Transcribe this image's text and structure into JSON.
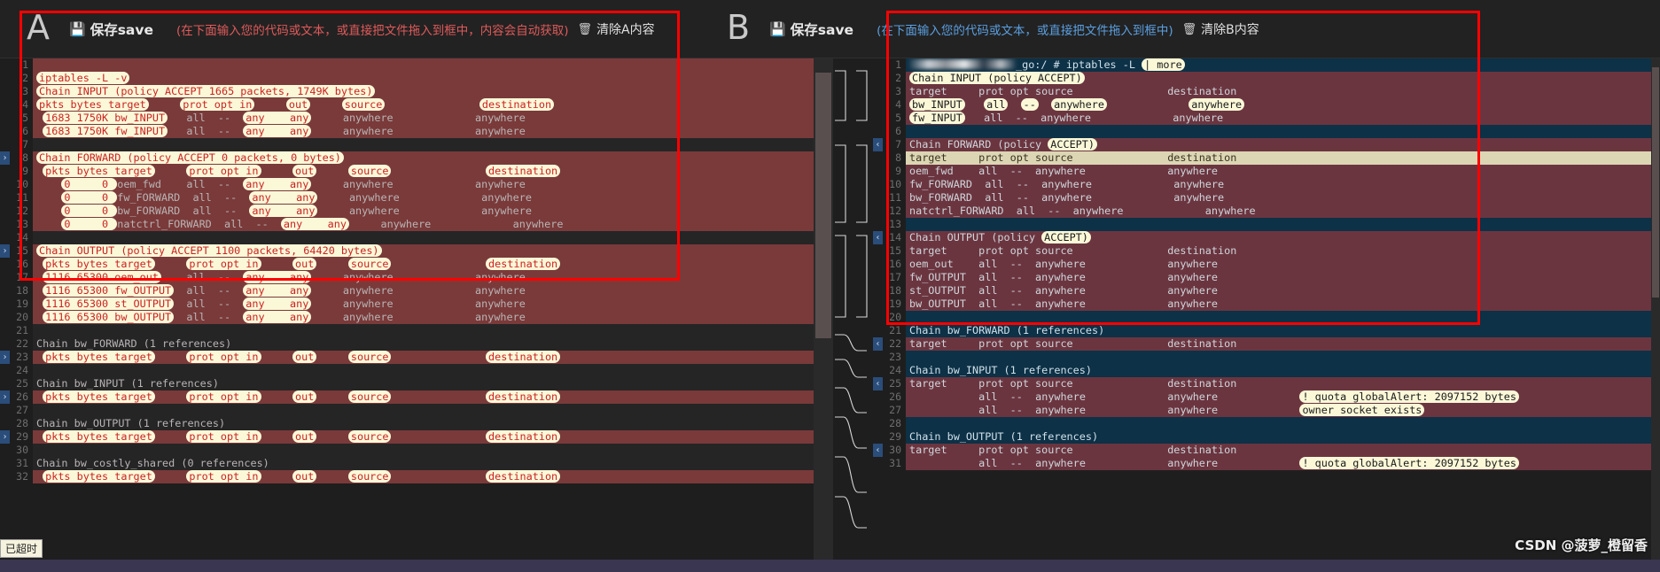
{
  "header": {
    "panel_a": {
      "letter": "A",
      "save_label": "保存save",
      "save_icon": "save-icon",
      "hint": "(在下面输入您的代码或文本，或直接把文件拖入到框中，内容会自动获取)",
      "clear_label": "清除A内容",
      "trash_icon": "trash-icon"
    },
    "panel_b": {
      "letter": "B",
      "save_label": "保存save",
      "save_icon": "save-icon",
      "hint": "(在下面输入您的代码或文本，或直接把文件拖入到框中)",
      "clear_label": "清除B内容",
      "trash_icon": "trash-icon"
    }
  },
  "status": {
    "timeout_badge": "已超时",
    "watermark": "CSDN @菠萝_橙留香"
  },
  "left_pane": {
    "lines": [
      {
        "n": "1",
        "bg": "del",
        "text": "",
        "partial": true
      },
      {
        "n": "2",
        "bg": "del",
        "text": "iptables -L -v",
        "tokens": [
          "iptables -L -v"
        ]
      },
      {
        "n": "3",
        "bg": "del",
        "text": "Chain INPUT (policy ACCEPT 1665 packets, 1749K bytes)"
      },
      {
        "n": "4",
        "bg": "del",
        "text": "pkts bytes target     prot opt in     out     source               destination"
      },
      {
        "n": "5",
        "bg": "del",
        "text": " 1683 1750K bw_INPUT   all  --  any    any     anywhere             anywhere"
      },
      {
        "n": "6",
        "bg": "del",
        "text": " 1683 1750K fw_INPUT   all  --  any    any     anywhere             anywhere"
      },
      {
        "n": "7",
        "bg": "none",
        "text": ""
      },
      {
        "n": "8",
        "bg": "del",
        "text": "Chain FORWARD (policy ACCEPT 0 packets, 0 bytes)",
        "fold": true
      },
      {
        "n": "9",
        "bg": "del",
        "text": " pkts bytes target     prot opt in     out     source               destination"
      },
      {
        "n": "10",
        "bg": "del",
        "text": "    0     0 oem_fwd    all  --  any    any     anywhere             anywhere"
      },
      {
        "n": "11",
        "bg": "del",
        "text": "    0     0 fw_FORWARD  all  --  any    any     anywhere             anywhere"
      },
      {
        "n": "12",
        "bg": "del",
        "text": "    0     0 bw_FORWARD  all  --  any    any     anywhere             anywhere"
      },
      {
        "n": "13",
        "bg": "del",
        "text": "    0     0 natctrl_FORWARD  all  --  any    any     anywhere             anywhere"
      },
      {
        "n": "14",
        "bg": "none",
        "text": ""
      },
      {
        "n": "15",
        "bg": "del",
        "text": "Chain OUTPUT (policy ACCEPT 1100 packets, 64420 bytes)",
        "fold": true
      },
      {
        "n": "16",
        "bg": "del",
        "text": " pkts bytes target     prot opt in     out     source               destination"
      },
      {
        "n": "17",
        "bg": "del",
        "text": " 1116 65300 oem_out    all  --  any    any     anywhere             anywhere"
      },
      {
        "n": "18",
        "bg": "del",
        "text": " 1116 65300 fw_OUTPUT  all  --  any    any     anywhere             anywhere"
      },
      {
        "n": "19",
        "bg": "del",
        "text": " 1116 65300 st_OUTPUT  all  --  any    any     anywhere             anywhere"
      },
      {
        "n": "20",
        "bg": "del",
        "text": " 1116 65300 bw_OUTPUT  all  --  any    any     anywhere             anywhere"
      },
      {
        "n": "21",
        "bg": "none",
        "text": ""
      },
      {
        "n": "22",
        "bg": "none",
        "text": "Chain bw_FORWARD (1 references)"
      },
      {
        "n": "23",
        "bg": "del",
        "text": " pkts bytes target     prot opt in     out     source               destination",
        "fold": true
      },
      {
        "n": "24",
        "bg": "none",
        "text": ""
      },
      {
        "n": "25",
        "bg": "none",
        "text": "Chain bw_INPUT (1 references)"
      },
      {
        "n": "26",
        "bg": "del",
        "text": " pkts bytes target     prot opt in     out     source               destination",
        "fold": true
      },
      {
        "n": "27",
        "bg": "none",
        "text": ""
      },
      {
        "n": "28",
        "bg": "none",
        "text": "Chain bw_OUTPUT (1 references)"
      },
      {
        "n": "29",
        "bg": "del",
        "text": " pkts bytes target     prot opt in     out     source               destination",
        "fold": true
      },
      {
        "n": "30",
        "bg": "none",
        "text": ""
      },
      {
        "n": "31",
        "bg": "none",
        "text": "Chain bw_costly_shared (0 references)"
      },
      {
        "n": "32",
        "bg": "del",
        "text": " pkts bytes target     prot opt in     out     source               destination"
      }
    ]
  },
  "right_pane": {
    "lines": [
      {
        "n": "1",
        "bg": "add",
        "text": "_go:/ # iptables -L | more",
        "redacted": true
      },
      {
        "n": "2",
        "bg": "mod",
        "text": "Chain INPUT (policy ACCEPT)"
      },
      {
        "n": "3",
        "bg": "mod",
        "text": "target     prot opt source               destination"
      },
      {
        "n": "4",
        "bg": "mod",
        "text": "bw_INPUT   all  --  anywhere             anywhere"
      },
      {
        "n": "5",
        "bg": "mod",
        "text": "fw_INPUT   all  --  anywhere             anywhere"
      },
      {
        "n": "6",
        "bg": "add",
        "text": ""
      },
      {
        "n": "7",
        "bg": "mod",
        "text": "Chain FORWARD (policy ACCEPT)",
        "fold": true
      },
      {
        "n": "8",
        "bg": "hl",
        "text": "target     prot opt source               destination"
      },
      {
        "n": "9",
        "bg": "mod",
        "text": "oem_fwd    all  --  anywhere             anywhere"
      },
      {
        "n": "10",
        "bg": "mod",
        "text": "fw_FORWARD  all  --  anywhere             anywhere"
      },
      {
        "n": "11",
        "bg": "mod",
        "text": "bw_FORWARD  all  --  anywhere             anywhere"
      },
      {
        "n": "12",
        "bg": "mod",
        "text": "natctrl_FORWARD  all  --  anywhere             anywhere"
      },
      {
        "n": "13",
        "bg": "add",
        "text": ""
      },
      {
        "n": "14",
        "bg": "mod",
        "text": "Chain OUTPUT (policy ACCEPT)",
        "fold": true
      },
      {
        "n": "15",
        "bg": "mod",
        "text": "target     prot opt source               destination"
      },
      {
        "n": "16",
        "bg": "mod",
        "text": "oem_out    all  --  anywhere             anywhere"
      },
      {
        "n": "17",
        "bg": "mod",
        "text": "fw_OUTPUT  all  --  anywhere             anywhere"
      },
      {
        "n": "18",
        "bg": "mod",
        "text": "st_OUTPUT  all  --  anywhere             anywhere"
      },
      {
        "n": "19",
        "bg": "mod",
        "text": "bw_OUTPUT  all  --  anywhere             anywhere"
      },
      {
        "n": "20",
        "bg": "add",
        "text": ""
      },
      {
        "n": "21",
        "bg": "add",
        "text": "Chain bw_FORWARD (1 references)"
      },
      {
        "n": "22",
        "bg": "mod",
        "text": "target     prot opt source               destination",
        "fold": true
      },
      {
        "n": "23",
        "bg": "add",
        "text": ""
      },
      {
        "n": "24",
        "bg": "add",
        "text": "Chain bw_INPUT (1 references)"
      },
      {
        "n": "25",
        "bg": "mod",
        "text": "target     prot opt source               destination",
        "fold": true
      },
      {
        "n": "26",
        "bg": "mod",
        "text": "           all  --  anywhere             anywhere             ! quota globalAlert: 2097152 bytes"
      },
      {
        "n": "27",
        "bg": "mod",
        "text": "           all  --  anywhere             anywhere             owner socket exists"
      },
      {
        "n": "28",
        "bg": "add",
        "text": ""
      },
      {
        "n": "29",
        "bg": "add",
        "text": "Chain bw_OUTPUT (1 references)"
      },
      {
        "n": "30",
        "bg": "mod",
        "text": "target     prot opt source               destination",
        "fold": true
      },
      {
        "n": "31",
        "bg": "mod",
        "text": "           all  --  anywhere             anywhere             ! quota globalAlert: 2097152 bytes"
      }
    ]
  },
  "annotations": {
    "box_a_label": "annotation-box-left",
    "box_b_label": "annotation-box-right",
    "color": "#ff0000"
  }
}
